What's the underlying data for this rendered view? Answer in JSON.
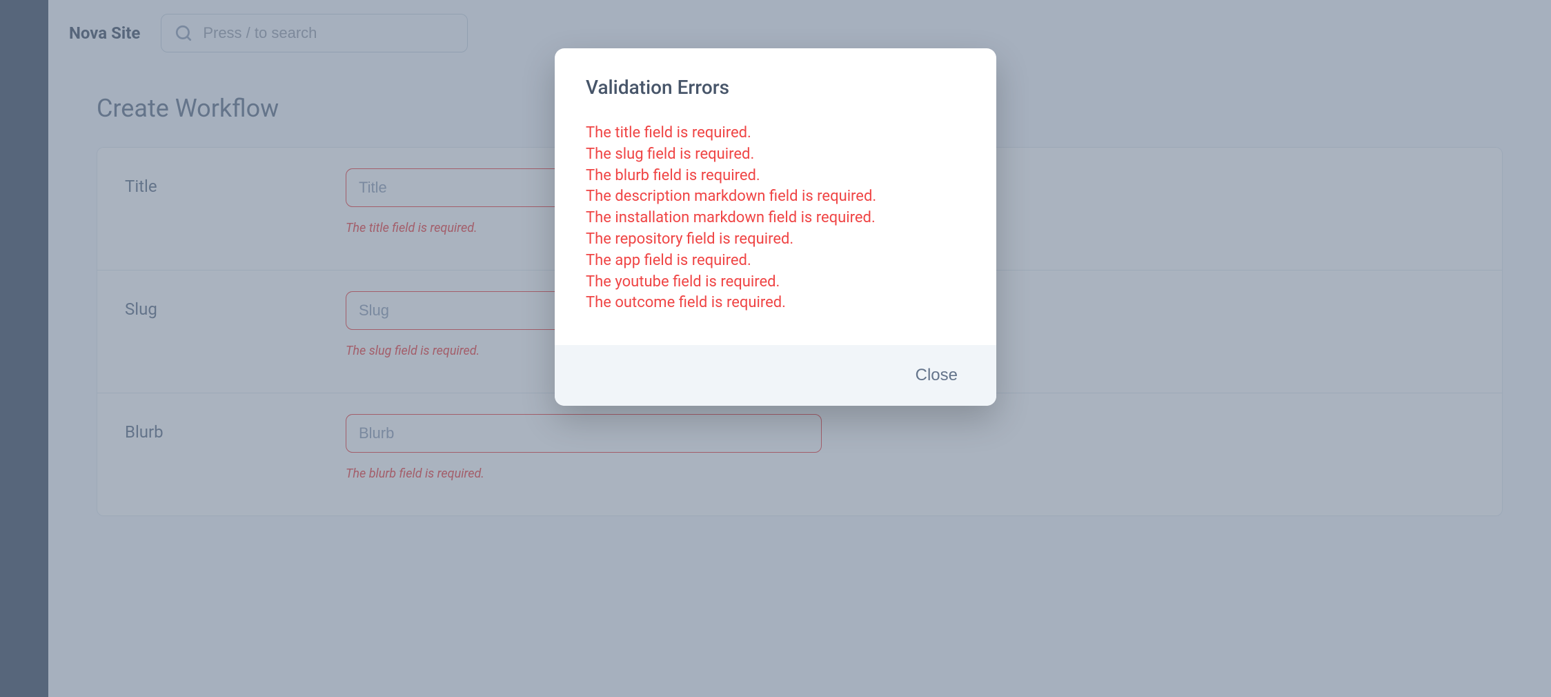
{
  "header": {
    "site_name": "Nova Site",
    "search_placeholder": "Press / to search"
  },
  "page": {
    "title": "Create Workflow"
  },
  "form": {
    "fields": [
      {
        "label": "Title",
        "placeholder": "Title",
        "error": "The title field is required."
      },
      {
        "label": "Slug",
        "placeholder": "Slug",
        "error": "The slug field is required."
      },
      {
        "label": "Blurb",
        "placeholder": "Blurb",
        "error": "The blurb field is required."
      }
    ]
  },
  "modal": {
    "title": "Validation Errors",
    "errors": [
      "The title field is required.",
      "The slug field is required.",
      "The blurb field is required.",
      "The description markdown field is required.",
      "The installation markdown field is required.",
      "The repository field is required.",
      "The app field is required.",
      "The youtube field is required.",
      "The outcome field is required."
    ],
    "close_label": "Close"
  }
}
